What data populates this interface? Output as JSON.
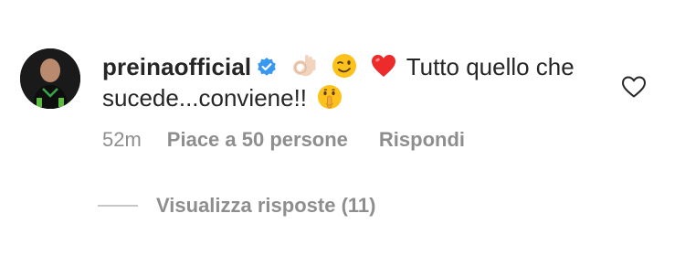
{
  "comment": {
    "username": "preinaofficial",
    "verified": true,
    "verified_icon": "verified-badge-icon",
    "emojis": [
      "ok-hand-emoji",
      "winking-face-emoji",
      "red-heart-emoji"
    ],
    "text_line": "Tutto quello che sucede...conviene!!",
    "trailing_emoji": "shushing-face-emoji",
    "like_icon": "heart-outline-icon"
  },
  "meta": {
    "time": "52m",
    "likes": "Piace a 50 persone",
    "reply": "Rispondi"
  },
  "replies": {
    "label": "Visualizza risposte (11)"
  },
  "colors": {
    "text": "#262626",
    "secondary": "#8e8e8e",
    "verified_blue": "#3897f0",
    "heart_red": "#ed2b2b"
  }
}
